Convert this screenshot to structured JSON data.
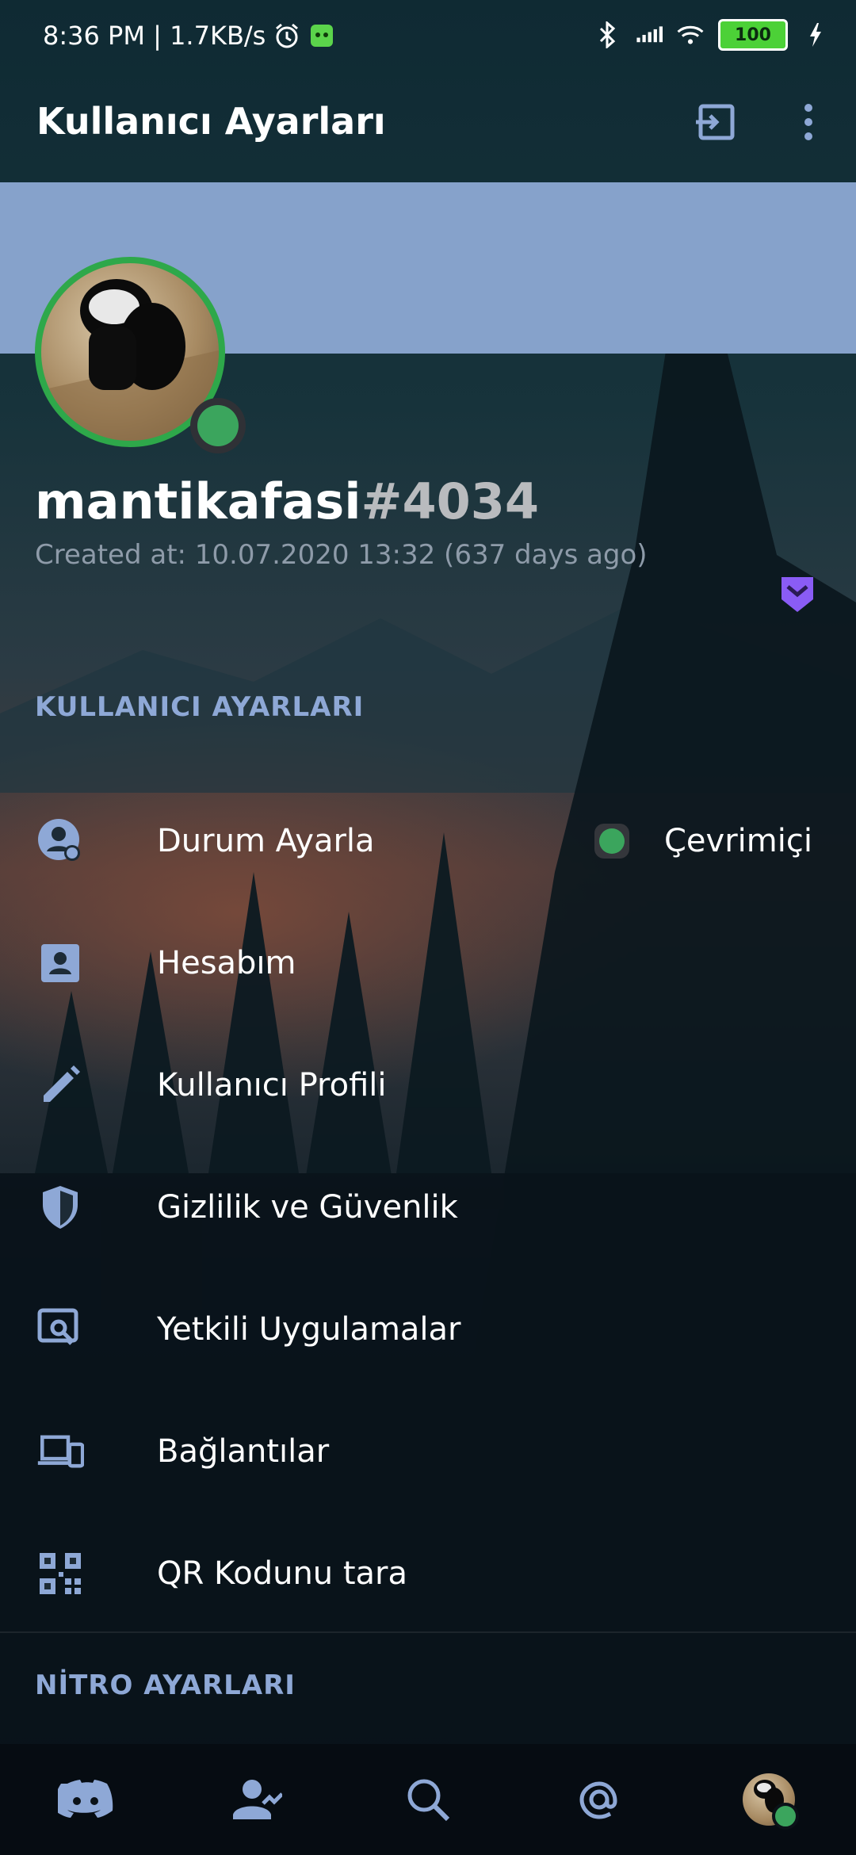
{
  "status_bar": {
    "time_speed": "8:36 PM | 1.7KB/s",
    "battery": "100"
  },
  "app_bar": {
    "title": "Kullanıcı Ayarları"
  },
  "profile": {
    "username": "mantikafasi",
    "discriminator": "#4034",
    "created": "Created at: 10.07.2020 13:32 (637 days ago)",
    "presence_color": "#3ba55d",
    "banner_color": "#86a2cb"
  },
  "sections": {
    "user_settings": "KULLANICI AYARLARI",
    "nitro_settings": "NİTRO AYARLARI"
  },
  "menu": {
    "items": [
      {
        "label": "Durum Ayarla",
        "icon": "user-status-icon",
        "value": "Çevrimiçi"
      },
      {
        "label": "Hesabım",
        "icon": "account-icon"
      },
      {
        "label": "Kullanıcı Profili",
        "icon": "pencil-icon"
      },
      {
        "label": "Gizlilik ve Güvenlik",
        "icon": "shield-icon"
      },
      {
        "label": "Yetkili Uygulamalar",
        "icon": "authorized-apps-icon"
      },
      {
        "label": "Bağlantılar",
        "icon": "devices-icon"
      },
      {
        "label": "QR Kodunu tara",
        "icon": "qr-code-icon"
      }
    ]
  },
  "bottom_nav": {
    "items": [
      "discord-home-icon",
      "friends-icon",
      "search-icon",
      "mentions-icon",
      "profile-avatar"
    ]
  },
  "colors": {
    "accent": "#8ea8d6",
    "online": "#3ba55d",
    "badge": "#8a5cf5"
  }
}
